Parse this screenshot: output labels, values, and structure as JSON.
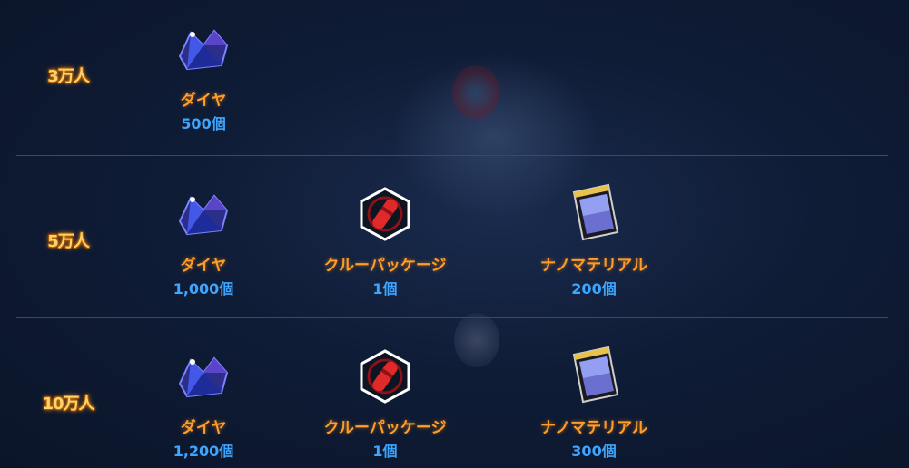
{
  "rows": [
    {
      "tier": "3万人",
      "rewards": [
        {
          "icon": "diamond-icon",
          "name": "ダイヤ",
          "qty": "500個"
        }
      ]
    },
    {
      "tier": "5万人",
      "rewards": [
        {
          "icon": "diamond-icon",
          "name": "ダイヤ",
          "qty": "1,000個"
        },
        {
          "icon": "crew-package-icon",
          "name": "クルーパッケージ",
          "qty": "1個"
        },
        {
          "icon": "nanomaterial-icon",
          "name": "ナノマテリアル",
          "qty": "200個"
        }
      ]
    },
    {
      "tier": "10万人",
      "rewards": [
        {
          "icon": "diamond-icon",
          "name": "ダイヤ",
          "qty": "1,200個"
        },
        {
          "icon": "crew-package-icon",
          "name": "クルーパッケージ",
          "qty": "1個"
        },
        {
          "icon": "nanomaterial-icon",
          "name": "ナノマテリアル",
          "qty": "300個"
        }
      ]
    }
  ],
  "colors": {
    "tier_text": "#ffd36b",
    "reward_name": "#ff9d2a",
    "reward_qty": "#3da6ff",
    "background": "#0f1c36"
  }
}
